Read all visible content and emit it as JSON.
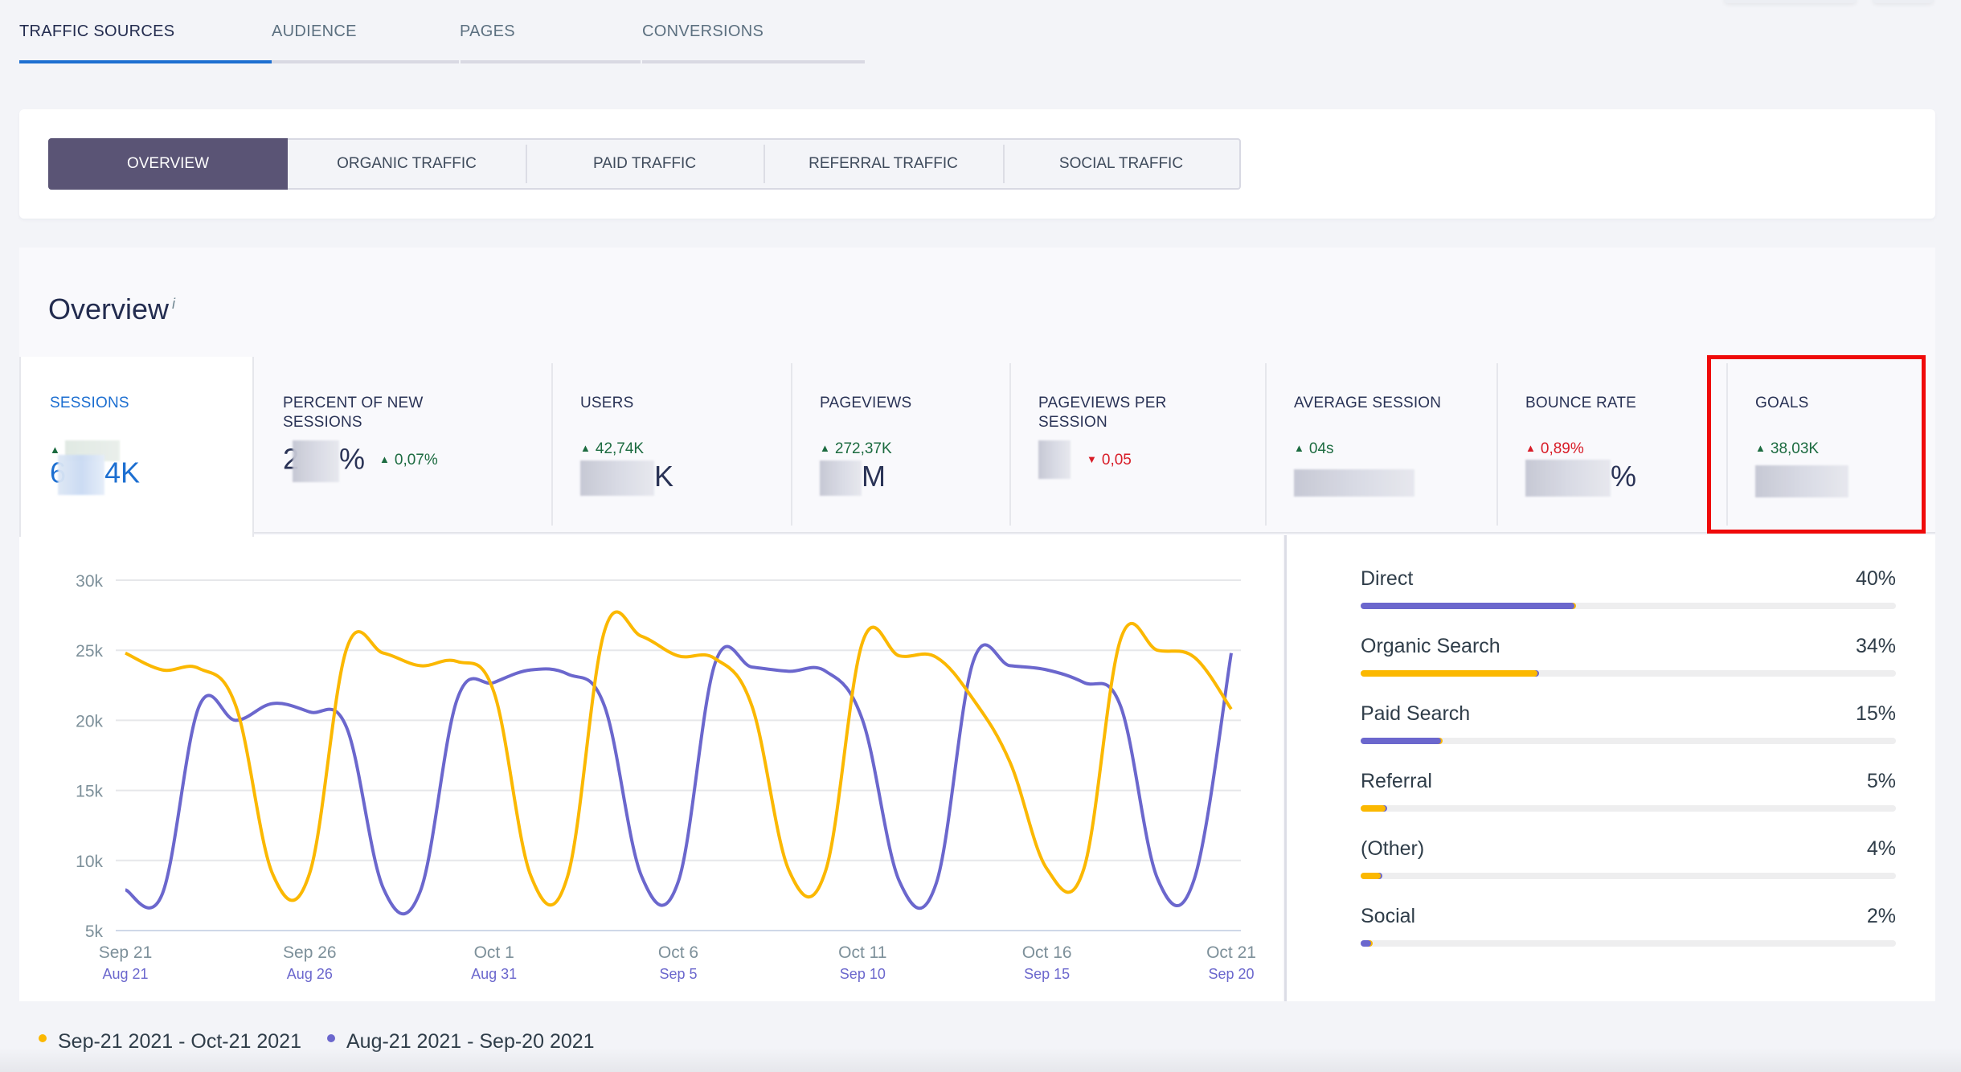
{
  "main_tabs": [
    {
      "label": "TRAFFIC SOURCES",
      "active": true
    },
    {
      "label": "AUDIENCE",
      "active": false
    },
    {
      "label": "PAGES",
      "active": false
    },
    {
      "label": "CONVERSIONS",
      "active": false
    }
  ],
  "sub_tabs": [
    {
      "label": "OVERVIEW",
      "active": true
    },
    {
      "label": "ORGANIC TRAFFIC",
      "active": false
    },
    {
      "label": "PAID TRAFFIC",
      "active": false
    },
    {
      "label": "REFERRAL TRAFFIC",
      "active": false
    },
    {
      "label": "SOCIAL TRAFFIC",
      "active": false
    }
  ],
  "overview": {
    "title": "Overview",
    "info_icon": "i"
  },
  "metrics": [
    {
      "label": "SESSIONS",
      "delta": "",
      "delta_direction": "up",
      "value_visible_prefix": "6",
      "value_visible_suffix": "4K",
      "value_redacted": true,
      "active": true
    },
    {
      "label": "PERCENT OF NEW SESSIONS",
      "delta": "0,07%",
      "delta_direction": "up",
      "value_visible_prefix": "2",
      "value_visible_suffix": "%",
      "value_redacted": true
    },
    {
      "label": "USERS",
      "delta": "42,74K",
      "delta_direction": "up",
      "value_visible_prefix": "",
      "value_visible_suffix": "K",
      "value_redacted": true
    },
    {
      "label": "PAGEVIEWS",
      "delta": "272,37K",
      "delta_direction": "up",
      "value_visible_prefix": "",
      "value_visible_suffix": "M",
      "value_redacted": true
    },
    {
      "label": "PAGEVIEWS PER SESSION",
      "delta": "0,05",
      "delta_direction": "down",
      "value_visible_prefix": "",
      "value_visible_suffix": "",
      "value_redacted": true
    },
    {
      "label": "AVERAGE SESSION",
      "delta": "04s",
      "delta_direction": "up",
      "value_visible_prefix": "",
      "value_visible_suffix": "",
      "value_redacted": true
    },
    {
      "label": "BOUNCE RATE",
      "delta": "0,89%",
      "delta_direction": "up-bad",
      "value_visible_prefix": "",
      "value_visible_suffix": "%",
      "value_redacted": true
    },
    {
      "label": "GOALS",
      "delta": "38,03K",
      "delta_direction": "up",
      "value_visible_prefix": "",
      "value_visible_suffix": "",
      "value_redacted": true,
      "highlighted": true
    }
  ],
  "traffic_breakdown": [
    {
      "name": "Direct",
      "percent": "40%",
      "fraction": 0.4,
      "color": "#6b67cd",
      "tip_color": "#fbb800"
    },
    {
      "name": "Organic Search",
      "percent": "34%",
      "fraction": 0.33,
      "color": "#fbb800",
      "tip_color": "#6b67cd"
    },
    {
      "name": "Paid Search",
      "percent": "15%",
      "fraction": 0.15,
      "color": "#6b67cd",
      "tip_color": "#fbb800"
    },
    {
      "name": "Referral",
      "percent": "5%",
      "fraction": 0.047,
      "color": "#fbb800",
      "tip_color": "#6b67cd"
    },
    {
      "name": "(Other)",
      "percent": "4%",
      "fraction": 0.038,
      "color": "#fbb800",
      "tip_color": "#6b67cd"
    },
    {
      "name": "Social",
      "percent": "2%",
      "fraction": 0.02,
      "color": "#6b67cd",
      "tip_color": "#fbb800"
    }
  ],
  "legend": [
    {
      "label": "Sep-21 2021 - Oct-21 2021",
      "color": "#fbb800"
    },
    {
      "label": "Aug-21 2021 - Sep-20 2021",
      "color": "#6b67cd"
    }
  ],
  "chart_data": {
    "type": "line",
    "title": "",
    "xlabel": "",
    "ylabel": "",
    "ylim": [
      5000,
      30000
    ],
    "y_ticks": [
      5000,
      10000,
      15000,
      20000,
      25000,
      30000
    ],
    "y_tick_labels": [
      "5k",
      "10k",
      "15k",
      "20k",
      "25k",
      "30k"
    ],
    "x_tick_labels_primary": [
      "Sep 21",
      "Sep 26",
      "Oct 1",
      "Oct 6",
      "Oct 11",
      "Oct 16",
      "Oct 21"
    ],
    "x_tick_labels_secondary": [
      "Aug 21",
      "Aug 26",
      "Aug 31",
      "Sep 5",
      "Sep 10",
      "Sep 15",
      "Sep 20"
    ],
    "x_tick_day_index": [
      0,
      5,
      10,
      15,
      20,
      25,
      30
    ],
    "grid": true,
    "legend_position": "bottom-left",
    "series": [
      {
        "name": "Sep-21 2021 - Oct-21 2021",
        "color": "#fbb800",
        "values": [
          24800,
          23600,
          23700,
          21000,
          9000,
          9100,
          25100,
          24800,
          23900,
          24200,
          22000,
          8900,
          8900,
          26400,
          26000,
          24600,
          24400,
          21000,
          9300,
          9300,
          25600,
          24600,
          24500,
          21500,
          17000,
          9400,
          9400,
          25800,
          25000,
          24500,
          20800
        ]
      },
      {
        "name": "Aug-21 2021 - Sep-20 2021",
        "color": "#6b67cd",
        "values": [
          7900,
          7600,
          21000,
          20000,
          21200,
          20600,
          19500,
          8000,
          7800,
          21500,
          22700,
          23600,
          23300,
          21000,
          8900,
          8500,
          24100,
          23800,
          23500,
          23500,
          20000,
          8500,
          8400,
          24200,
          23900,
          23600,
          22700,
          21000,
          8700,
          8700,
          24800
        ]
      }
    ]
  }
}
